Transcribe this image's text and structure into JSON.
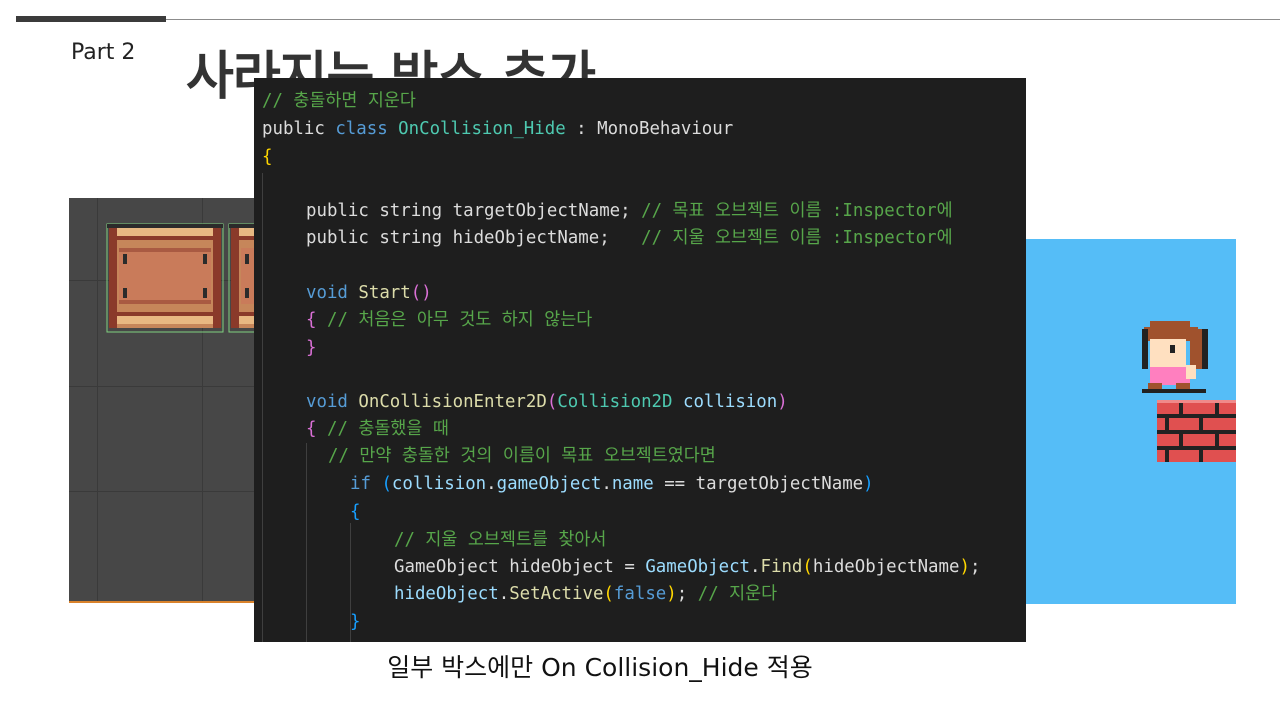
{
  "slide": {
    "part_label": "Part 2",
    "title": "사라지는 박스 추가",
    "caption": "일부 박스에만 On Collision_Hide 적용"
  },
  "code": {
    "l1": {
      "comment": "// 충돌하면 지운다"
    },
    "l2": {
      "kw_public": "public",
      "kw_class": "class",
      "class_name": "OnCollision_Hide",
      "colon": " : ",
      "base": "MonoBehaviour"
    },
    "l3": {
      "brace": "{"
    },
    "l5": {
      "kw1": "public",
      "kw2": "string",
      "name": "targetObjectName;",
      "comment": "// 목표 오브젝트 이름 :Inspector에"
    },
    "l6": {
      "kw1": "public",
      "kw2": "string",
      "name": "hideObjectName;",
      "comment": "// 지울 오브젝트 이름 :Inspector에"
    },
    "l8": {
      "kw": "void",
      "fn": "Start",
      "paren": "()"
    },
    "l9": {
      "brace": "{",
      "comment": "// 처음은 아무 것도 하지 않는다"
    },
    "l10": {
      "brace": "}"
    },
    "l12": {
      "kw": "void",
      "fn": "OnCollisionEnter2D",
      "popen": "(",
      "type": "Collision2D",
      "param": "collision",
      "pclose": ")"
    },
    "l13": {
      "brace": "{",
      "comment": "// 충돌했을 때"
    },
    "l14": {
      "comment": "// 만약 충돌한 것의 이름이 목표 오브젝트였다면"
    },
    "l15": {
      "kw": "if",
      "popen": "(",
      "obj": "collision",
      "dot1": ".",
      "prop1": "gameObject",
      "dot2": ".",
      "prop2": "name",
      "op": " == ",
      "var": "targetObjectName",
      "pclose": ")"
    },
    "l16": {
      "brace": "{"
    },
    "l17": {
      "comment": "// 지울 오브젝트를 찾아서"
    },
    "l18": {
      "type": "GameObject",
      "var": "hideObject",
      "eq": " = ",
      "type2": "GameObject",
      "dot": ".",
      "fn": "Find",
      "popen": "(",
      "arg": "hideObjectName",
      "pclose": ")",
      "semi": ";"
    },
    "l19": {
      "var": "hideObject",
      "dot": ".",
      "fn": "SetActive",
      "popen": "(",
      "kw": "false",
      "pclose": ")",
      "semi": ";",
      "comment": "// 지운다"
    },
    "l20": {
      "brace": "}"
    }
  },
  "colors": {
    "editor_bg": "#1e1e1e",
    "comment": "#57a64a",
    "keyword": "#569cd6",
    "type": "#4ec9b0",
    "method": "#dcdcaa",
    "variable": "#9cdcfe",
    "game_sky": "#55bdf7",
    "scene_bg": "#474747"
  }
}
